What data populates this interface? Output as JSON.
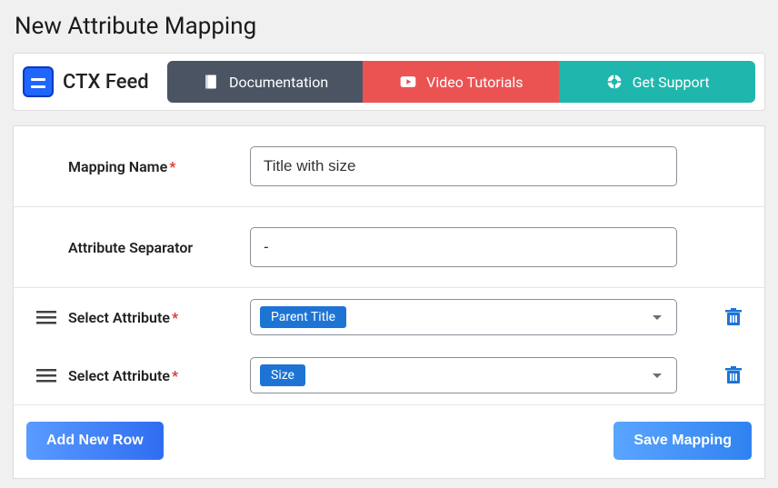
{
  "page": {
    "title": "New Attribute Mapping"
  },
  "brand": {
    "name": "CTX Feed"
  },
  "tabs": {
    "doc": "Documentation",
    "video": "Video Tutorials",
    "sup": "Get Support"
  },
  "form": {
    "mapping_name": {
      "label": "Mapping Name",
      "required": "*",
      "value": "Title with size"
    },
    "separator": {
      "label": "Attribute Separator",
      "value": "-"
    },
    "attr_rows": [
      {
        "label": "Select Attribute",
        "required": "*",
        "value": "Parent Title"
      },
      {
        "label": "Select Attribute",
        "required": "*",
        "value": "Size"
      }
    ]
  },
  "buttons": {
    "add": "Add New Row",
    "save": "Save Mapping"
  }
}
